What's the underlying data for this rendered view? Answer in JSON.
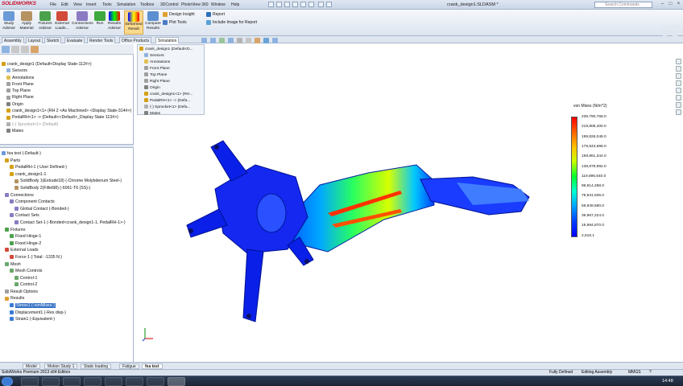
{
  "app": {
    "logo": "SOLIDWORKS",
    "doc_title": "crank_design1.SLDASM *"
  },
  "menu": [
    "File",
    "Edit",
    "View",
    "Insert",
    "Tools",
    "Simulation",
    "Toolbox",
    "3DControl",
    "PhotoView 360",
    "Window",
    "Help"
  ],
  "search": {
    "placeholder": "Search Commands"
  },
  "ribbon": {
    "buttons": [
      "Study Advisor",
      "Apply Material",
      "Fixtures Advisor",
      "External Loads...",
      "Connections Advisor",
      "Run",
      "Results Advisor",
      "Deformed Result",
      "Compare Results"
    ],
    "small": [
      "Design Insight",
      "Plot Tools",
      "Report",
      "Include Image for Report"
    ]
  },
  "tabs": [
    "Assembly",
    "Layout",
    "Sketch",
    "Evaluate",
    "Render Tools",
    "Office Products",
    "Simulation"
  ],
  "feature_tree": [
    {
      "label": "crank_design1  (Default<Display State-112#>)",
      "gray": false
    },
    {
      "label": "Sensors",
      "gray": false
    },
    {
      "label": "Annotations",
      "gray": false
    },
    {
      "label": "Front Plane",
      "gray": false
    },
    {
      "label": "Top Plane",
      "gray": false
    },
    {
      "label": "Right Plane",
      "gray": false
    },
    {
      "label": "Origin",
      "gray": false
    },
    {
      "label": "crank_design1<1> (RH 2 <As Machined> <Display State-314#>)",
      "gray": false
    },
    {
      "label": "PedalRH<1> -> (Default<<Default>_Display State 113#>)",
      "gray": false
    },
    {
      "label": "(-) Sprocket<1> (Default)",
      "gray": true
    },
    {
      "label": "Mates",
      "gray": false
    }
  ],
  "flyout_tree": [
    "crank_design1  (Default<D...",
    "Sensors",
    "Annotations",
    "Front Plane",
    "Top Plane",
    "Right Plane",
    "Origin",
    "crank_design1<1> (RH...",
    "PedalRH<1> -> (Defa...",
    "(-) Sprocket<1> (Defa...",
    "Mates"
  ],
  "study_tree": [
    {
      "label": "fea test (-Default-)",
      "sel": false
    },
    {
      "label": "Parts",
      "sel": false
    },
    {
      "label": "PedalRH-1 (-User Defined-)",
      "sel": false
    },
    {
      "label": "crank_design1-1",
      "sel": false
    },
    {
      "label": "SolidBody 1(Extrude18) (-Chrome Molybdenum Steel-)",
      "sel": false
    },
    {
      "label": "SolidBody 2(Fillet98) (-6061-T6 (SS)-)",
      "sel": false
    },
    {
      "label": "Connections",
      "sel": false
    },
    {
      "label": "Component Contacts",
      "sel": false
    },
    {
      "label": "Global Contact (-Bonded-)",
      "sel": false
    },
    {
      "label": "Contact Sets",
      "sel": false
    },
    {
      "label": "Contact Set-1 (-Bonded<crank_design1-1, PedalRH-1>-)",
      "sel": false
    },
    {
      "label": "Fixtures",
      "sel": false
    },
    {
      "label": "Fixed Hinge-1",
      "sel": false
    },
    {
      "label": "Fixed Hinge-2",
      "sel": false
    },
    {
      "label": "External Loads",
      "sel": false
    },
    {
      "label": "Force-1 (:Total: -1335 N:)",
      "sel": false
    },
    {
      "label": "Mesh",
      "sel": false
    },
    {
      "label": "Mesh Controls",
      "sel": false
    },
    {
      "label": "Control-1",
      "sel": false
    },
    {
      "label": "Control-2",
      "sel": false
    },
    {
      "label": "Result Options",
      "sel": false
    },
    {
      "label": "Results",
      "sel": false
    },
    {
      "label": "Stress1 (-vonMises-)",
      "sel": true
    },
    {
      "label": "Displacement1 (-Res disp-)",
      "sel": false
    },
    {
      "label": "Strain1 (-Equivalent-)",
      "sel": false
    }
  ],
  "legend": {
    "title": "von Mises (N/m^2)",
    "values": [
      "239,790,768.0",
      "219,808,400.0",
      "199,826,048.0",
      "179,843,696.0",
      "159,861,344.0",
      "139,878,992.0",
      "119,896,640.0",
      "99,914,288.0",
      "79,931,936.0",
      "59,949,580.0",
      "39,967,224.0",
      "19,984,870.0",
      "2,516.1"
    ]
  },
  "bottom_tabs": [
    "Model",
    "Motion Study 1",
    "Static loading",
    "Fatigue",
    "fea test"
  ],
  "status": {
    "left": "SolidWorks Premium 2013 x64 Edition",
    "state": "Fully Defined",
    "mode": "Editing Assembly",
    "units": "MMGS",
    "help": "?"
  },
  "taskbar": {
    "time": "14:48"
  },
  "colors": {
    "accent": "#3471c4",
    "brand": "#c8102e",
    "ribbon": "#dde5f0"
  }
}
